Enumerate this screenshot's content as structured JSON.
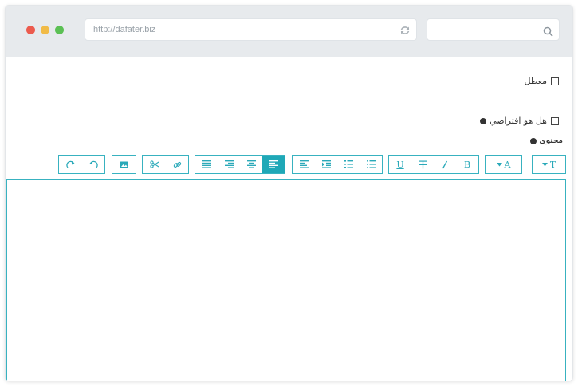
{
  "browser": {
    "url": "http://dafater.biz",
    "search_value": ""
  },
  "form": {
    "disabled_checkbox_label": "معطل",
    "default_checkbox_label": "هل هو افتراضي",
    "content_label": "محتوى"
  },
  "toolbar": {
    "text_style_label": "T",
    "font_size_label": "A",
    "bold_label": "B",
    "underline_label": "U",
    "active_button": "align-right"
  },
  "editor": {
    "value": ""
  },
  "colors": {
    "accent": "#1fa8b7",
    "chrome": "#e7eaed"
  }
}
